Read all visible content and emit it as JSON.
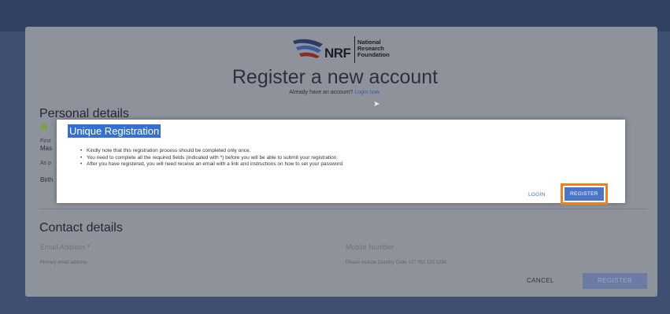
{
  "header": {
    "logo_abbrev": "NRF",
    "logo_lines": [
      "National",
      "Research",
      "Foundation"
    ],
    "title": "Register a new account",
    "subtitle_prefix": "Already have an account?",
    "login_link": "Login now."
  },
  "personal": {
    "title": "Personal details",
    "badge": "ID",
    "fragments": [
      "First",
      "Mas",
      "As p",
      "Birth"
    ]
  },
  "contact": {
    "title": "Contact details",
    "email_label": "Email Address *",
    "email_hint": "Primary email address",
    "mobile_label": "Mobile Number",
    "mobile_hint": "Please include Country Code +27 082 123 1234"
  },
  "footer": {
    "cancel_label": "CANCEL",
    "register_label": "REGISTER"
  },
  "dialog": {
    "title": "Unique Registration",
    "items": [
      "Kindly note that this registration process should be completed only once.",
      "You need to complete all the required fields (indicated with *) before you will be able to submit your registration.",
      "After you have registered, you will need receive an email with a link and instructions on how to set your password"
    ],
    "login_label": "LOGIN",
    "register_label": "REGISTER"
  },
  "colors": {
    "highlight": "#f07f1f",
    "primary": "#4a76c9",
    "title_highlight": "#3470d2"
  }
}
